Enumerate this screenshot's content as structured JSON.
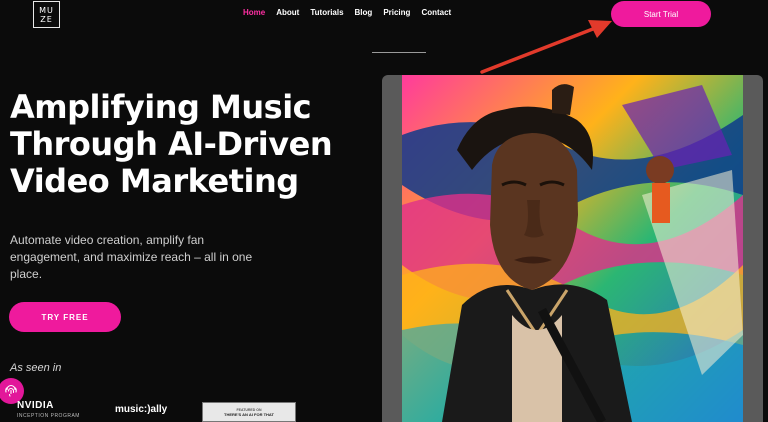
{
  "brand": {
    "logo_line1": "MU",
    "logo_line2": "ZE"
  },
  "nav": {
    "links": [
      "Home",
      "About",
      "Tutorials",
      "Blog",
      "Pricing",
      "Contact"
    ],
    "active": "Home",
    "cta_label": "Start Trial"
  },
  "hero": {
    "headline": "Amplifying Music Through AI-Driven Video Marketing",
    "subcopy": "Automate video creation, amplify fan engagement, and maximize reach – all in one place.",
    "cta_label": "TRY FREE",
    "seen_in": "As seen in"
  },
  "press": {
    "nvidia": "NVIDIA",
    "nvidia_sub": "INCEPTION PROGRAM",
    "musically": "music:)ally",
    "badge_small": "FEATURED ON",
    "badge_text": "THERE'S AN AI FOR THAT"
  },
  "colors": {
    "accent": "#ef1a9d",
    "background": "#0b0b0b",
    "active_link": "#ff2fa3"
  },
  "icons": [
    "fingerprint-icon",
    "annotation-arrow"
  ]
}
